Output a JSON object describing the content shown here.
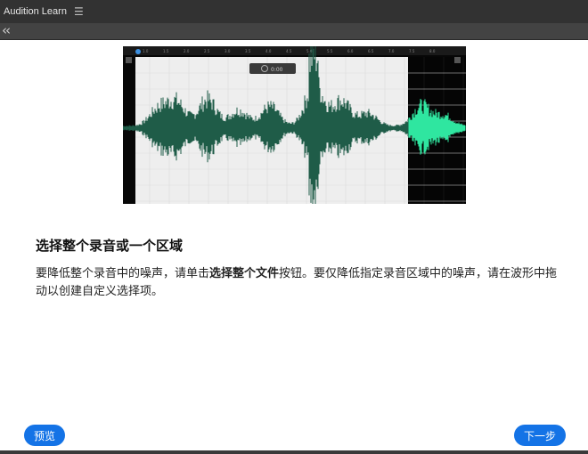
{
  "app": {
    "title": "Audition Learn",
    "menu_icon": "hamburger-icon",
    "back_icon": "double-chevron-left-icon"
  },
  "waveform": {
    "ruler_ticks": [
      "1.0",
      "1.5",
      "2.0",
      "2.5",
      "3.0",
      "3.5",
      "4.0",
      "4.5",
      "5.0",
      "5.5",
      "6.0",
      "6.5",
      "7.0",
      "7.5",
      "8.0"
    ],
    "hud_time": "0:00",
    "colors": {
      "wave": "#1f5c48",
      "wave_selected": "#2fe6a0",
      "background": "#eeeeee",
      "selection_bg": "#050505"
    }
  },
  "lesson": {
    "heading": "选择整个录音或一个区域",
    "text_1": "要降低整个录音中的噪声，请单击",
    "text_bold": "选择整个文件",
    "text_2": "按钮。要仅降低指定录音区域中的噪声，请在波形中拖动以创建自定义选择项。"
  },
  "buttons": {
    "prev": "预览",
    "next": "下一步"
  },
  "colors": {
    "accent": "#1473e6",
    "titlebar": "#323232"
  }
}
